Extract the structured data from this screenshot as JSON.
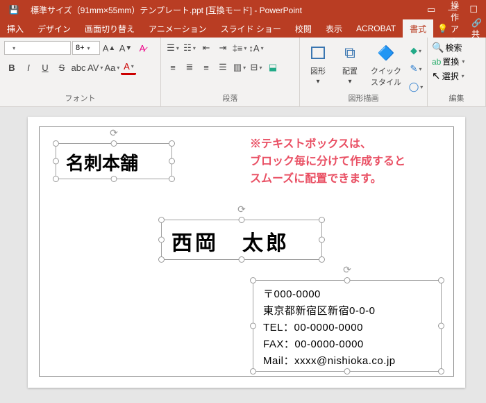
{
  "titlebar": {
    "title": "標準サイズ（91mm×55mm）テンプレート.ppt [互換モード] - PowerPoint"
  },
  "tabs": {
    "insert": "挿入",
    "design": "デザイン",
    "transition": "画面切り替え",
    "animation": "アニメーション",
    "slideshow": "スライド ショー",
    "review": "校閲",
    "view": "表示",
    "acrobat": "ACROBAT",
    "format": "書式",
    "tell_me": "操作アシス"
  },
  "ribbon": {
    "font_size": "8+",
    "bold": "B",
    "italic": "I",
    "underline": "U",
    "strike": "S",
    "font_group": "フォント",
    "paragraph_group": "段落",
    "drawing_group": "図形描画",
    "editing_group": "編集",
    "shapes": "図形",
    "arrange": "配置",
    "quick_styles": "クイック\nスタイル",
    "find": "検索",
    "replace": "置換",
    "select": "選択"
  },
  "slide": {
    "textbox1": "名刺本舗",
    "textbox2": "西岡　太郎",
    "address": {
      "postal": "〒000-0000",
      "addr": "東京都新宿区新宿0-0-0",
      "tel": "TEL：00-0000-0000",
      "fax": "FAX：00-0000-0000",
      "mail": "Mail：xxxx@nishioka.co.jp"
    },
    "note_l1": "※テキストボックスは、",
    "note_l2": "ブロック毎に分けて作成すると",
    "note_l3": "スムーズに配置できます。"
  }
}
